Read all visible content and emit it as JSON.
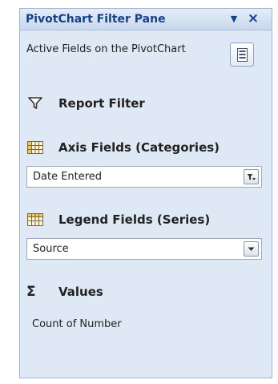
{
  "pane": {
    "title": "PivotChart Filter Pane",
    "intro": "Active Fields on the PivotChart"
  },
  "sections": {
    "report_filter": {
      "label": "Report Filter",
      "icon": "funnel-icon"
    },
    "axis_fields": {
      "label": "Axis Fields (Categories)",
      "icon": "grid-icon",
      "value": "Date Entered"
    },
    "legend_fields": {
      "label": "Legend Fields (Series)",
      "icon": "grid-icon",
      "value": "Source"
    },
    "values": {
      "label": "Values",
      "icon": "sigma-icon",
      "item": "Count of  Number"
    }
  },
  "glyphs": {
    "sigma": "Σ",
    "dropdown": "▼",
    "close": "×"
  },
  "colors": {
    "title_text": "#15428b",
    "pane_bg": "#dfe9f5"
  }
}
